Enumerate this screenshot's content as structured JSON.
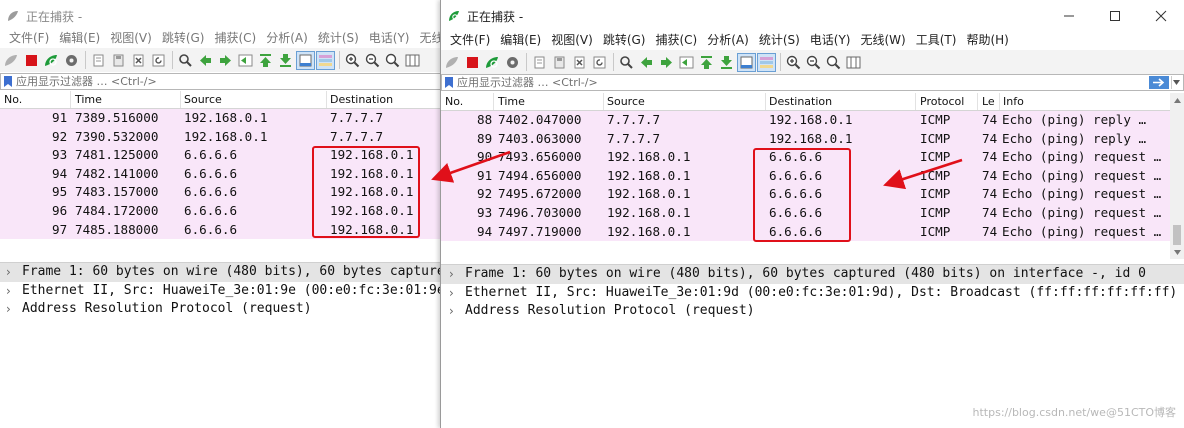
{
  "left": {
    "title": "正在捕获 -",
    "menus": [
      "文件(F)",
      "编辑(E)",
      "视图(V)",
      "跳转(G)",
      "捕获(C)",
      "分析(A)",
      "统计(S)",
      "电话(Y)",
      "无线("
    ],
    "filter_placeholder": "应用显示过滤器 … <Ctrl-/>",
    "columns": [
      "No.",
      "Time",
      "Source",
      "Destination"
    ],
    "rows": [
      {
        "no": "91",
        "time": "7389.516000",
        "src": "192.168.0.1",
        "dst": "7.7.7.7"
      },
      {
        "no": "92",
        "time": "7390.532000",
        "src": "192.168.0.1",
        "dst": "7.7.7.7"
      },
      {
        "no": "93",
        "time": "7481.125000",
        "src": "6.6.6.6",
        "dst": "192.168.0.1"
      },
      {
        "no": "94",
        "time": "7482.141000",
        "src": "6.6.6.6",
        "dst": "192.168.0.1"
      },
      {
        "no": "95",
        "time": "7483.157000",
        "src": "6.6.6.6",
        "dst": "192.168.0.1"
      },
      {
        "no": "96",
        "time": "7484.172000",
        "src": "6.6.6.6",
        "dst": "192.168.0.1"
      },
      {
        "no": "97",
        "time": "7485.188000",
        "src": "6.6.6.6",
        "dst": "192.168.0.1"
      }
    ],
    "details": [
      "Frame 1: 60 bytes on wire (480 bits), 60 bytes capture",
      "Ethernet II, Src: HuaweiTe_3e:01:9e (00:e0:fc:3e:01:9e",
      "Address Resolution Protocol (request)"
    ]
  },
  "right": {
    "title": "正在捕获 -",
    "menus": [
      "文件(F)",
      "编辑(E)",
      "视图(V)",
      "跳转(G)",
      "捕获(C)",
      "分析(A)",
      "统计(S)",
      "电话(Y)",
      "无线(W)",
      "工具(T)",
      "帮助(H)"
    ],
    "filter_placeholder": "应用显示过滤器 … <Ctrl-/>",
    "columns": [
      "No.",
      "Time",
      "Source",
      "Destination",
      "Protocol",
      "Le",
      "Info"
    ],
    "rows": [
      {
        "no": "88",
        "time": "7402.047000",
        "src": "7.7.7.7",
        "dst": "192.168.0.1",
        "proto": "ICMP",
        "len": "74",
        "info": "Echo (ping) reply  …"
      },
      {
        "no": "89",
        "time": "7403.063000",
        "src": "7.7.7.7",
        "dst": "192.168.0.1",
        "proto": "ICMP",
        "len": "74",
        "info": "Echo (ping) reply  …"
      },
      {
        "no": "90",
        "time": "7493.656000",
        "src": "192.168.0.1",
        "dst": "6.6.6.6",
        "proto": "ICMP",
        "len": "74",
        "info": "Echo (ping) request …"
      },
      {
        "no": "91",
        "time": "7494.656000",
        "src": "192.168.0.1",
        "dst": "6.6.6.6",
        "proto": "ICMP",
        "len": "74",
        "info": "Echo (ping) request …"
      },
      {
        "no": "92",
        "time": "7495.672000",
        "src": "192.168.0.1",
        "dst": "6.6.6.6",
        "proto": "ICMP",
        "len": "74",
        "info": "Echo (ping) request …"
      },
      {
        "no": "93",
        "time": "7496.703000",
        "src": "192.168.0.1",
        "dst": "6.6.6.6",
        "proto": "ICMP",
        "len": "74",
        "info": "Echo (ping) request …"
      },
      {
        "no": "94",
        "time": "7497.719000",
        "src": "192.168.0.1",
        "dst": "6.6.6.6",
        "proto": "ICMP",
        "len": "74",
        "info": "Echo (ping) request …"
      }
    ],
    "details": [
      "Frame 1: 60 bytes on wire (480 bits), 60 bytes captured (480 bits) on interface -, id 0",
      "Ethernet II, Src: HuaweiTe_3e:01:9d (00:e0:fc:3e:01:9d), Dst: Broadcast (ff:ff:ff:ff:ff:ff)",
      "Address Resolution Protocol (request)"
    ]
  },
  "watermark": "https://blog.csdn.net/we@51CTO博客",
  "colors": {
    "row_highlight": "#f9e6f9",
    "annotation_red": "#e0101a",
    "toolbar_bg": "#f3f3f3",
    "shark_green": "#1e9b3a"
  },
  "icons": {
    "window_controls": [
      "minimize-icon",
      "maximize-icon",
      "close-icon"
    ],
    "toolbar": [
      "shark-fin-start-icon",
      "stop-icon",
      "restart-icon",
      "options-gear-icon",
      "open-folder-icon",
      "save-file-icon",
      "close-file-icon",
      "reload-icon",
      "find-icon",
      "go-back-icon",
      "go-forward-icon",
      "go-to-packet-icon",
      "go-first-icon",
      "go-last-icon",
      "autoscroll-icon",
      "colorize-icon",
      "zoom-in-icon",
      "zoom-out-icon",
      "zoom-normal-icon",
      "resize-columns-icon"
    ]
  }
}
